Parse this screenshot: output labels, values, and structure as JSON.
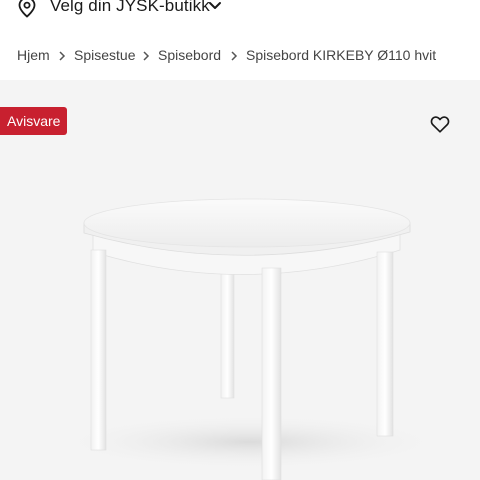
{
  "store_selector": {
    "label": "Velg din JYSK-butikk",
    "icon": "location-pin-icon",
    "chevron": "chevron-down-icon"
  },
  "breadcrumb": {
    "items": [
      "Hjem",
      "Spisestue",
      "Spisebord",
      "Spisebord KIRKEBY Ø110 hvit"
    ],
    "separator_icon": "chevron-right-icon"
  },
  "product": {
    "badge": "Avisvare",
    "badge_color": "#c8202f",
    "favorite_icon": "heart-outline-icon",
    "image_subject": "white round dining table"
  }
}
